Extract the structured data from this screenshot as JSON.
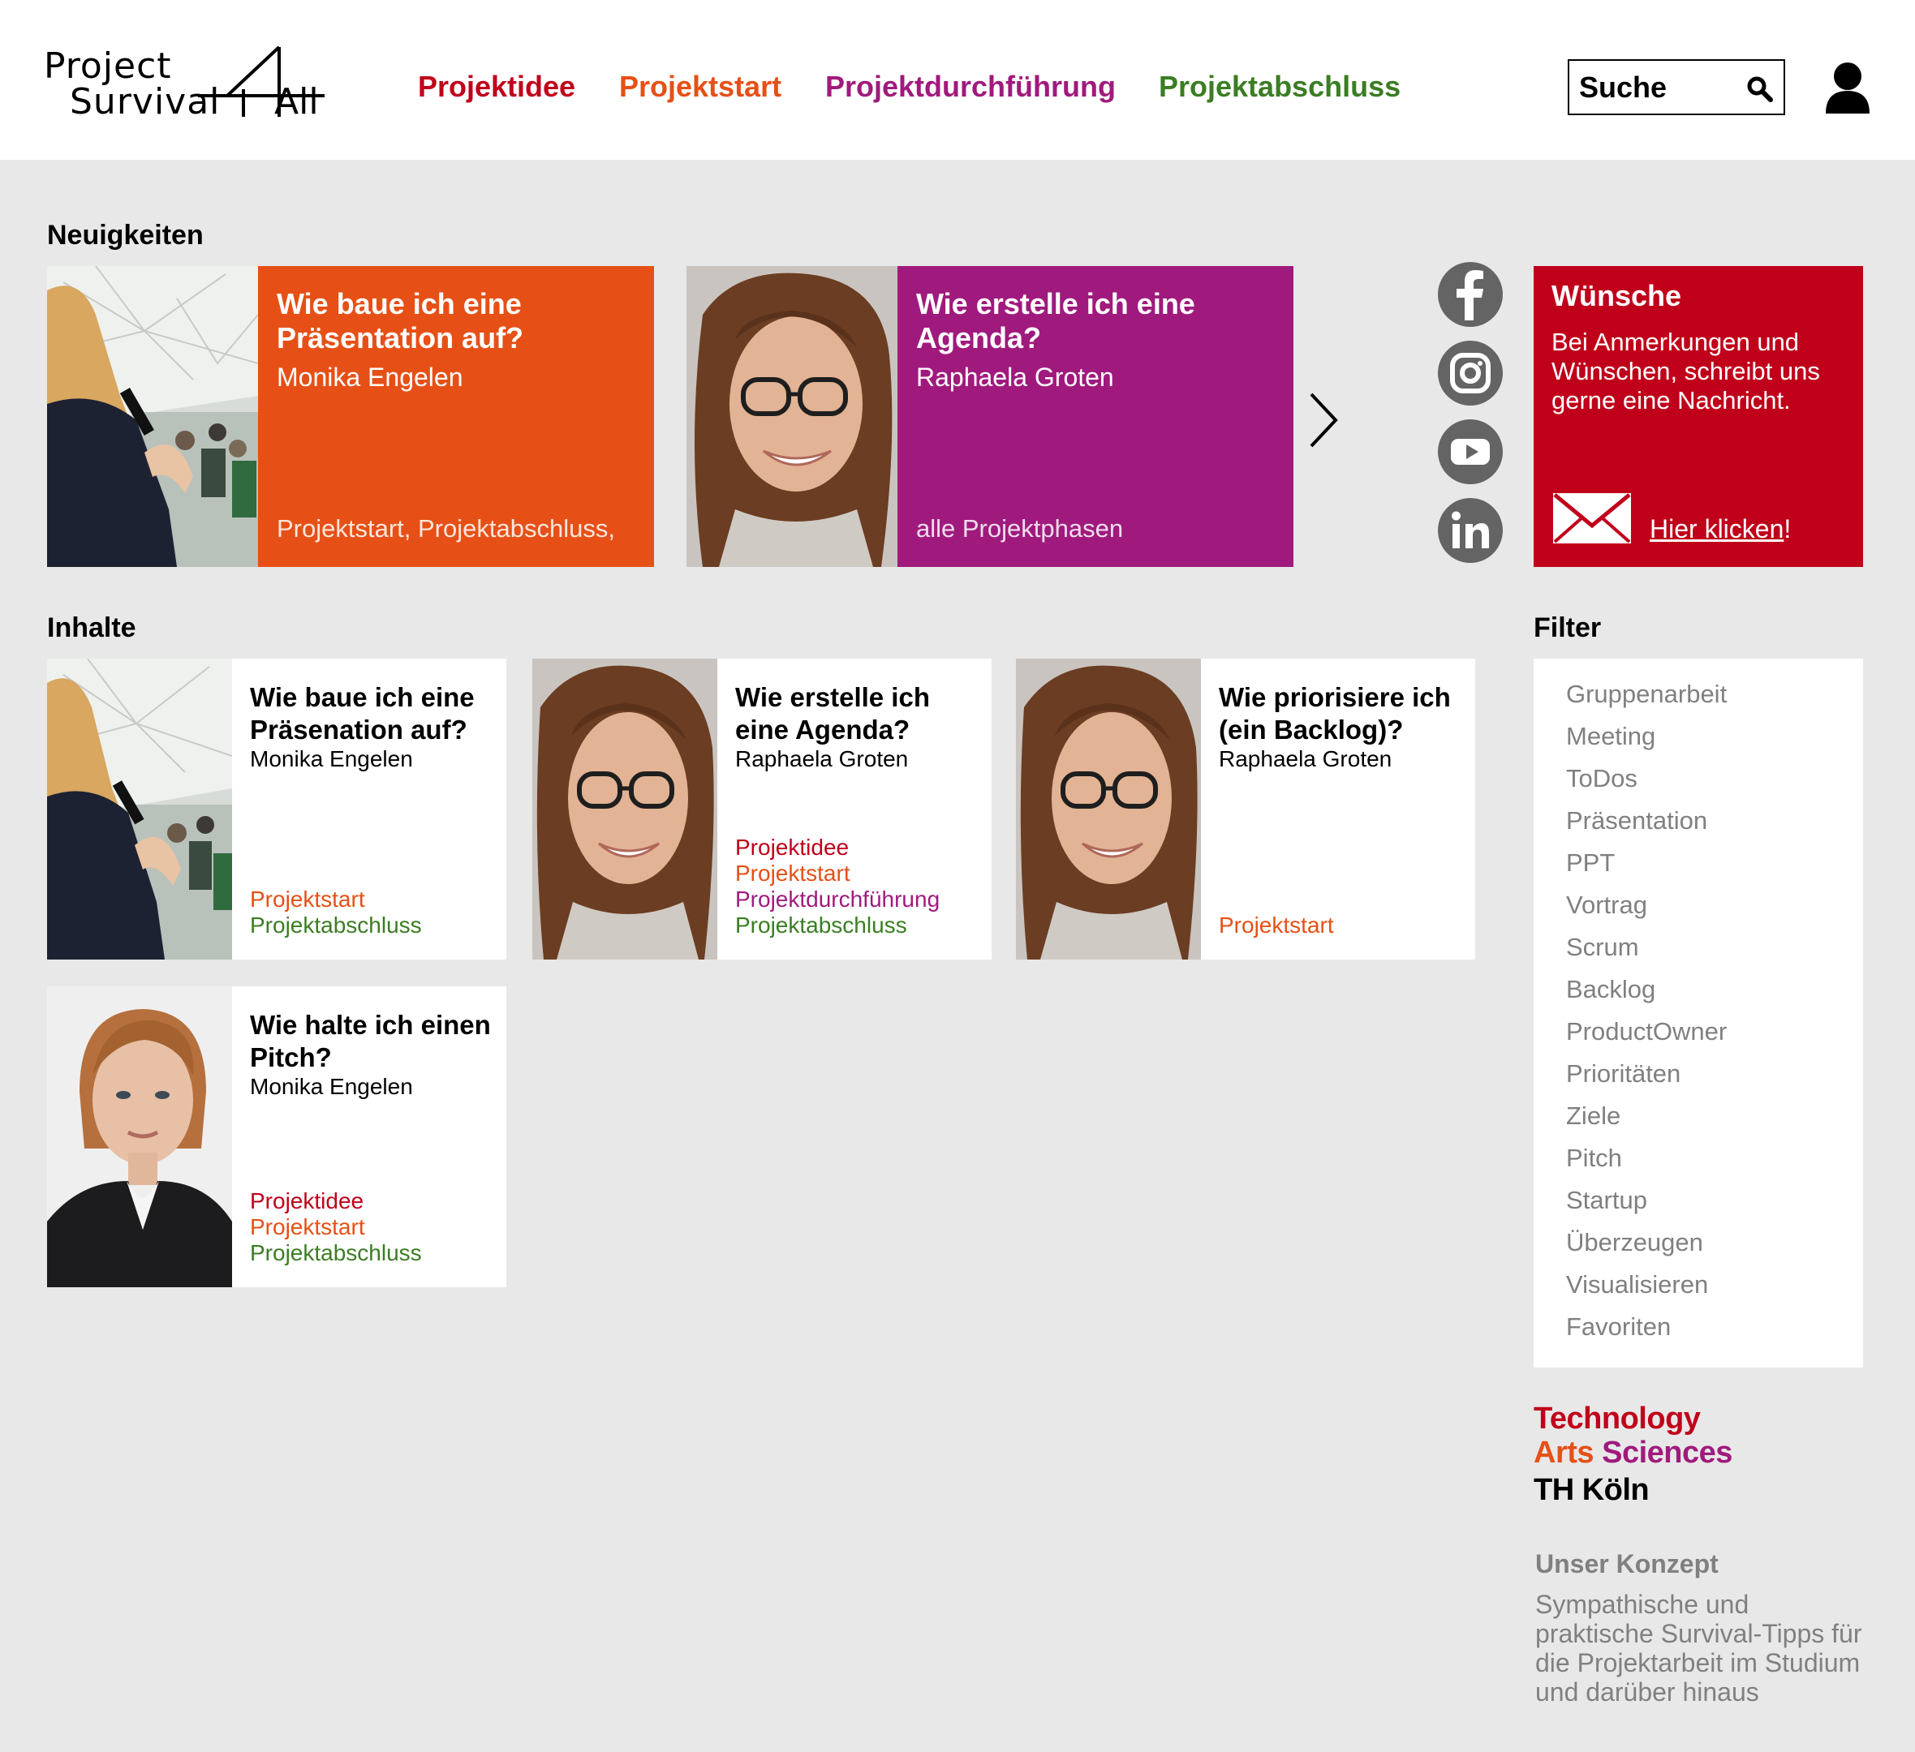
{
  "logo": {
    "line1": "Project",
    "line2": "Survival",
    "four": "4",
    "all": "All"
  },
  "nav": [
    {
      "label": "Projektidee",
      "color": "#c0001a"
    },
    {
      "label": "Projektstart",
      "color": "#e65016"
    },
    {
      "label": "Projektdurchführung",
      "color": "#a01a7d"
    },
    {
      "label": "Projektabschluss",
      "color": "#3b7d23"
    }
  ],
  "search": {
    "placeholder": "Suche",
    "icon": "search-icon"
  },
  "user": {
    "icon": "user-icon"
  },
  "news": {
    "title": "Neuigkeiten",
    "items": [
      {
        "title": "Wie baue ich eine Präsentation auf?",
        "author": "Monika Engelen",
        "tags": "Projektstart, Projektabschluss,",
        "color": "#e65016"
      },
      {
        "title": "Wie erstelle ich eine Agenda?",
        "author": "Raphaela Groten",
        "tags": "alle Projektphasen",
        "color": "#a01a7d"
      }
    ],
    "next_icon": "chevron-right-icon"
  },
  "social": [
    "facebook-icon",
    "instagram-icon",
    "youtube-icon",
    "linkedin-icon"
  ],
  "wishes": {
    "title": "Wünsche",
    "text": "Bei Anmerkungen und Wünschen, schreibt uns gerne eine Nachricht.",
    "link": "Hier klicken",
    "link_suffix": "!",
    "icon": "mail-icon"
  },
  "contents": {
    "title": "Inhalte",
    "items": [
      {
        "title": "Wie baue ich eine Präsenation auf?",
        "author": "Monika Engelen",
        "tags": [
          "Projektstart",
          "Projektabschluss"
        ]
      },
      {
        "title": "Wie erstelle ich eine Agenda?",
        "author": "Raphaela Groten",
        "tags": [
          "Projektidee",
          "Projektstart",
          "Projektdurchführung",
          "Projektabschluss"
        ]
      },
      {
        "title": "Wie priorisiere ich (ein Backlog)?",
        "author": "Raphaela Groten",
        "tags": [
          "Projektstart"
        ]
      },
      {
        "title": "Wie halte ich einen Pitch?",
        "author": "Monika Engelen",
        "tags": [
          "Projektidee",
          "Projektstart",
          "Projektabschluss"
        ]
      }
    ]
  },
  "filter": {
    "title": "Filter",
    "items": [
      "Gruppenarbeit",
      "Meeting",
      "ToDos",
      "Präsentation",
      "PPT",
      "Vortrag",
      "Scrum",
      "Backlog",
      "ProductOwner",
      "Prioritäten",
      "Ziele",
      "Pitch",
      "Startup",
      "Überzeugen",
      "Visualisieren",
      "Favoriten"
    ]
  },
  "th": {
    "line1": "Technology",
    "line2a": "Arts",
    "line2b": "Sciences",
    "line3": "TH Köln"
  },
  "concept": {
    "title": "Unser Konzept",
    "text": "Sympathische und praktische Survival-Tipps für die Projektarbeit im Studium und darüber hinaus"
  }
}
